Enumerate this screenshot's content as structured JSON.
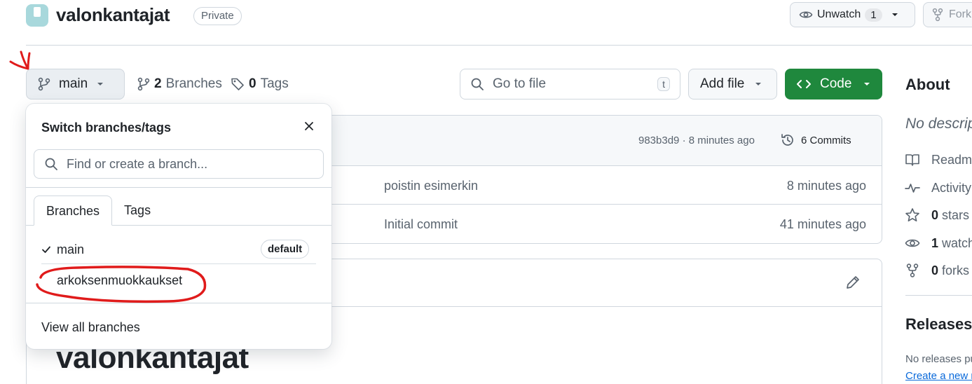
{
  "repo": {
    "name": "valonkantajat",
    "visibility": "Private"
  },
  "header_actions": {
    "unwatch_label": "Unwatch",
    "watch_count": "1",
    "fork_label": "Fork"
  },
  "toolbar": {
    "branch": "main",
    "branch_count": "2",
    "branches_label": "Branches",
    "tag_count": "0",
    "tags_label": "Tags",
    "go_to_file_placeholder": "Go to file",
    "go_to_file_key": "t",
    "add_file_label": "Add file",
    "code_label": "Code"
  },
  "latest_commit": {
    "sha_time": "983b3d9 · 8 minutes ago",
    "commits_label": "6 Commits"
  },
  "files": [
    {
      "message": "poistin esimerkin",
      "time": "8 minutes ago"
    },
    {
      "message": "Initial commit",
      "time": "41 minutes ago"
    }
  ],
  "readme": {
    "heading": "valonkantajat"
  },
  "sidebar": {
    "about_heading": "About",
    "description": "No description",
    "items": [
      {
        "icon": "book-icon",
        "bold": "",
        "text": "Readme"
      },
      {
        "icon": "pulse-icon",
        "bold": "",
        "text": "Activity"
      },
      {
        "icon": "star-icon",
        "bold": "0",
        "text": "stars"
      },
      {
        "icon": "eye-icon",
        "bold": "1",
        "text": "watching"
      },
      {
        "icon": "fork-icon",
        "bold": "0",
        "text": "forks"
      }
    ],
    "releases_heading": "Releases",
    "no_releases": "No releases published",
    "create_release": "Create a new release"
  },
  "dropdown": {
    "title": "Switch branches/tags",
    "search_placeholder": "Find or create a branch...",
    "tabs": [
      "Branches",
      "Tags"
    ],
    "active_tab": "Branches",
    "branches": [
      {
        "name": "main",
        "selected": true,
        "badge": "default"
      },
      {
        "name": "arkoksenmuokkaukset",
        "selected": false,
        "badge": ""
      }
    ],
    "footer": "View all branches"
  },
  "colors": {
    "primary_button": "#1f883d",
    "link": "#0969da",
    "annotation": "#e01b1b",
    "border": "#d0d7de"
  }
}
